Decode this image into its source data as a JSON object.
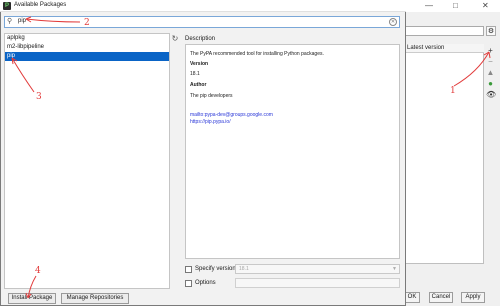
{
  "background": {
    "table_header": "Latest version",
    "ok_label": "OK",
    "cancel_label": "Cancel",
    "apply_label": "Apply"
  },
  "dialog": {
    "title": "Available Packages",
    "search": {
      "value": "pip"
    },
    "packages": [
      "aplpkg",
      "m2-libpipeline",
      "pip"
    ],
    "selected_index": 2,
    "description_label": "Description",
    "description": {
      "summary": "The PyPA recommended tool for installing Python packages.",
      "version_heading": "Version",
      "version": "18.1",
      "author_heading": "Author",
      "author": "The pip developers",
      "link_mail": "mailto:pypa-dev@groups.google.com",
      "link_site": "https://pip.pypa.io/"
    },
    "specify_version_label": "Specify version",
    "specify_version_value": "18.1",
    "options_label": "Options",
    "install_label": "Install Package",
    "manage_label": "Manage Repositories"
  },
  "annotations": [
    "1",
    "2",
    "3",
    "4"
  ],
  "annotation_color": "#e23b3b",
  "selection_color": "#0a64c6"
}
